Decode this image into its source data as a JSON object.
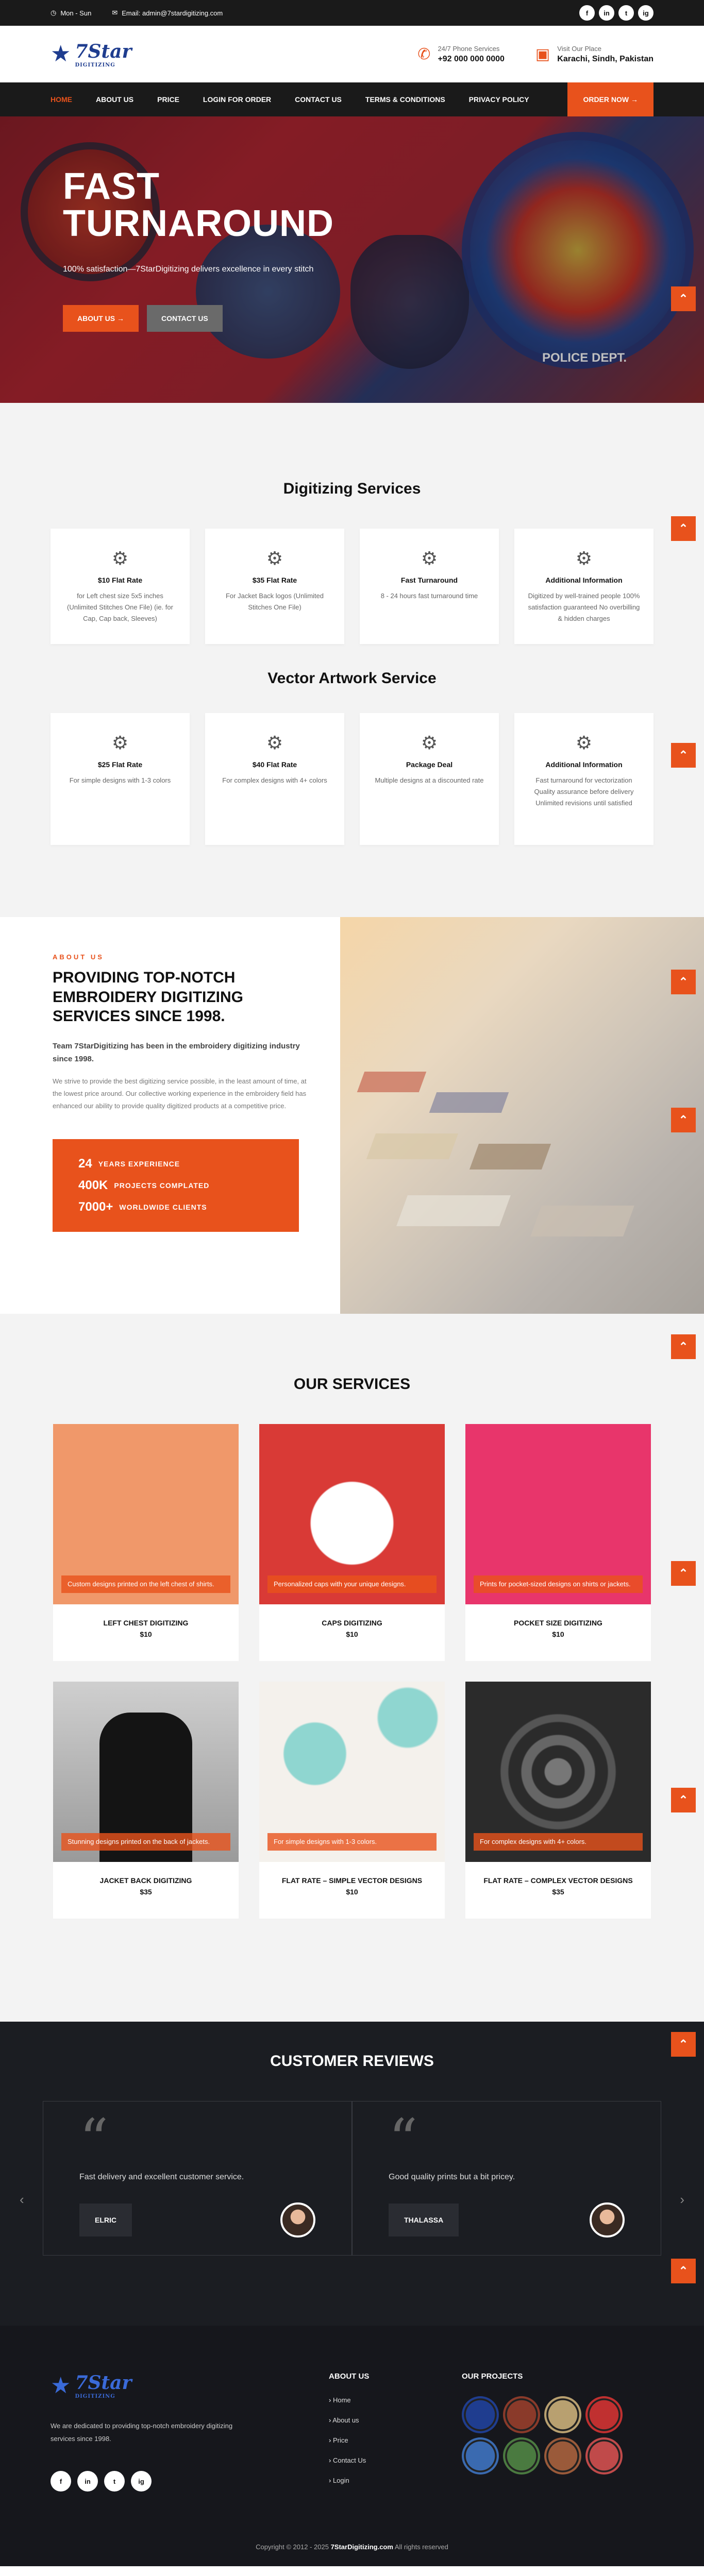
{
  "topbar": {
    "hours": "Mon - Sun",
    "email": "Email: admin@7stardigitizing.com",
    "socials": [
      "f",
      "in",
      "t",
      "ig"
    ]
  },
  "header": {
    "logo_text": "7Star",
    "logo_sub": "DIGITIZING",
    "phone_label": "24/7 Phone Services",
    "phone_value": "+92 000 000 0000",
    "place_label": "Visit Our Place",
    "place_value": "Karachi, Sindh, Pakistan"
  },
  "nav": {
    "items": [
      "HOME",
      "ABOUT US",
      "PRICE",
      "LOGIN FOR ORDER",
      "CONTACT US",
      "TERMS & CONDITIONS",
      "PRIVACY POLICY"
    ],
    "order_label": "ORDER NOW →"
  },
  "hero": {
    "title_line1": "FAST",
    "title_line2": "TURNAROUND",
    "tagline": "100% satisfaction—7StarDigitizing delivers excellence in every stitch",
    "btn_about": "ABOUT US →",
    "btn_contact": "CONTACT US",
    "patch_text": "POLICE DEPT."
  },
  "digitizing": {
    "title": "Digitizing Services",
    "cards": [
      {
        "title": "$10 Flat Rate",
        "desc": "for Left chest size 5x5 inches (Unlimited Stitches One File) (ie. for Cap, Cap back, Sleeves)"
      },
      {
        "title": "$35 Flat Rate",
        "desc": "For Jacket Back logos (Unlimited Stitches One File)"
      },
      {
        "title": "Fast Turnaround",
        "desc": "8 - 24 hours fast turnaround time"
      },
      {
        "title": "Additional Information",
        "desc": "Digitized by well-trained people 100% satisfaction guaranteed No overbilling & hidden charges"
      }
    ]
  },
  "vector": {
    "title": "Vector Artwork Service",
    "cards": [
      {
        "title": "$25 Flat Rate",
        "desc": "For simple designs with 1-3 colors"
      },
      {
        "title": "$40 Flat Rate",
        "desc": "For complex designs with 4+ colors"
      },
      {
        "title": "Package Deal",
        "desc": "Multiple designs at a discounted rate"
      },
      {
        "title": "Additional Information",
        "desc": "Fast turnaround for vectorization Quality assurance before delivery Unlimited revisions until satisfied"
      }
    ]
  },
  "about": {
    "kicker": "ABOUT US",
    "heading": "PROVIDING TOP-NOTCH EMBROIDERY DIGITIZING SERVICES SINCE 1998.",
    "lead": "Team 7StarDigitizing has been in the embroidery digitizing industry since 1998.",
    "body": "We strive to provide the best digitizing service possible, in the least amount of time, at the lowest price around. Our collective working experience in the embroidery field has enhanced our ability to provide quality digitized products at a competitive price.",
    "stats": [
      {
        "n": "24",
        "l": "YEARS EXPERIENCE"
      },
      {
        "n": "400K",
        "l": "PROJECTS COMPLATED"
      },
      {
        "n": "7000+",
        "l": "WORLDWIDE CLIENTS"
      }
    ]
  },
  "services": {
    "title": "OUR SERVICES",
    "items": [
      {
        "caption": "Custom designs printed on the left chest of shirts.",
        "name": "LEFT CHEST DIGITIZING",
        "price": "$10",
        "bg": "#f0986a"
      },
      {
        "caption": "Personalized caps with your unique designs.",
        "name": "CAPS DIGITIZING",
        "price": "$10",
        "bg": "#d93a36"
      },
      {
        "caption": "Prints for pocket-sized designs on shirts or jackets.",
        "name": "POCKET SIZE DIGITIZING",
        "price": "$10",
        "bg": "#e8356b"
      },
      {
        "caption": "Stunning designs printed on the back of jackets.",
        "name": "JACKET BACK DIGITIZING",
        "price": "$35",
        "bg": "#b8b8b8"
      },
      {
        "caption": "For simple designs with 1-3 colors.",
        "name": "FLAT RATE – SIMPLE VECTOR DESIGNS",
        "price": "$10",
        "bg": "#f4f1ec"
      },
      {
        "caption": "For complex designs with 4+ colors.",
        "name": "FLAT RATE – COMPLEX VECTOR DESIGNS",
        "price": "$35",
        "bg": "#2b2b2b"
      }
    ]
  },
  "reviews": {
    "title": "CUSTOMER REVIEWS",
    "items": [
      {
        "text": "Fast delivery and excellent customer service.",
        "name": "ELRIC"
      },
      {
        "text": "Good quality prints but a bit pricey.",
        "name": "THALASSA"
      }
    ]
  },
  "footer": {
    "about_text": "We are dedicated to providing top-notch embroidery digitizing services since 1998.",
    "col1_title": "ABOUT US",
    "col1_links": [
      "Home",
      "About us",
      "Price",
      "Contact Us",
      "Login"
    ],
    "col2_title": "OUR PROJECTS",
    "copyright_pre": "Copyright © 2012 - 2025",
    "copyright_brand": "7StarDigitizing.com",
    "copyright_post": "All rights reserved",
    "thumb_colors": [
      "#1f3d8f",
      "#8a3a2a",
      "#b8a070",
      "#c03030",
      "#3a6ab0",
      "#4a7a40",
      "#9a5a3a",
      "#c04a4a"
    ]
  },
  "colors": {
    "accent": "#e8521c",
    "dark": "#1a1a1a",
    "brand_blue": "#1f3d8f"
  }
}
